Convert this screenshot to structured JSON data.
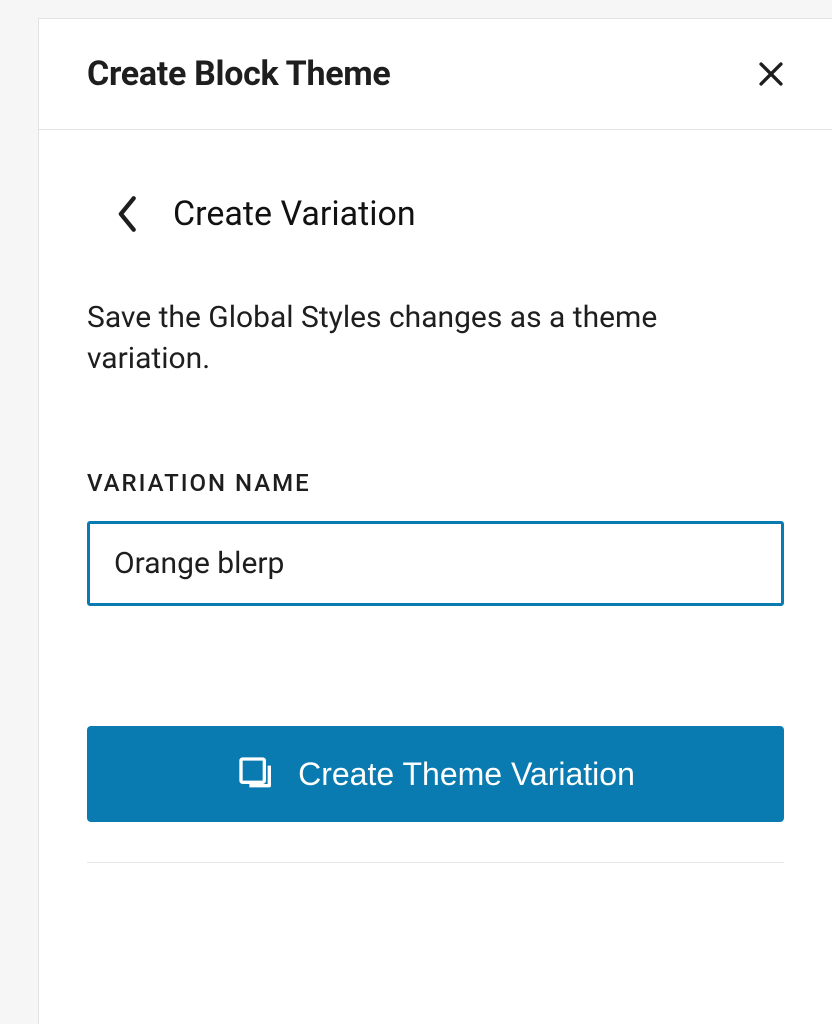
{
  "panel": {
    "title": "Create Block Theme",
    "sub_title": "Create Variation",
    "description": "Save the Global Styles changes as a theme variation.",
    "field_label": "VARIATION NAME",
    "input_value": "Orange blerp",
    "submit_label": "Create Theme Variation"
  },
  "icons": {
    "close": "close-icon",
    "back": "chevron-left-icon",
    "copy": "copy-icon"
  }
}
